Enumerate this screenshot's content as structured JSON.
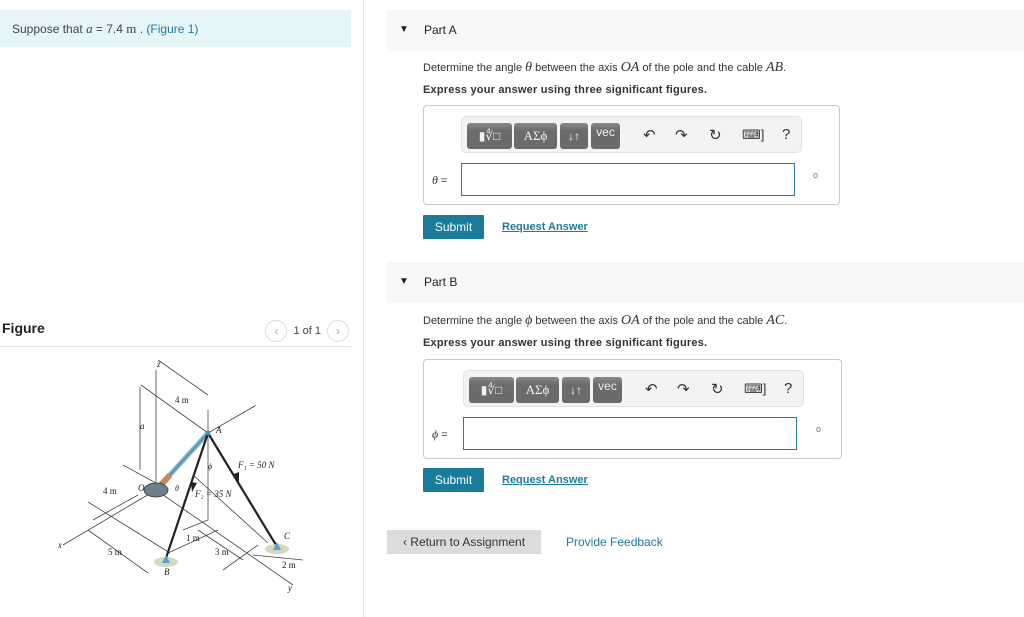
{
  "intro": {
    "prefix": "Suppose that ",
    "variable": "a",
    "equals": " = 7.4 ",
    "unit": "m",
    "suffix": " . ",
    "figure_link": "(Figure 1)"
  },
  "figure_panel": {
    "title": "Figure",
    "pager_text": "1 of 1",
    "prev_icon": "‹",
    "next_icon": "›",
    "labels": {
      "z": "z",
      "x": "x",
      "y": "y",
      "a": "a",
      "O": "O",
      "A": "A",
      "B": "B",
      "C": "C",
      "dim_4m_top": "4 m",
      "dim_4m_left": "4 m",
      "dim_5m": "5 m",
      "dim_1m": "1 m",
      "dim_3m": "3 m",
      "dim_2m": "2 m",
      "theta": "θ",
      "phi": "ϕ",
      "F1": "F₁ = 50 N",
      "F2": "F₂ = 35 N"
    }
  },
  "parts": [
    {
      "title": "Part A",
      "question_pre": "Determine the angle ",
      "symbol": "θ",
      "question_mid": " between the axis ",
      "axis": "OA",
      "question_mid2": " of the pole and the cable ",
      "cable": "AB",
      "question_end": ".",
      "instruction": "Express your answer using three significant figures.",
      "var_label": "θ",
      "input_value": "",
      "unit_symbol": "o",
      "submit_label": "Submit",
      "request_label": "Request Answer"
    },
    {
      "title": "Part B",
      "question_pre": "Determine the angle ",
      "symbol": "ϕ",
      "question_mid": " between the axis ",
      "axis": "OA",
      "question_mid2": " of the pole and the cable ",
      "cable": "AC",
      "question_end": ".",
      "instruction": "Express your answer using three significant figures.",
      "var_label": "ϕ",
      "input_value": "",
      "unit_symbol": "o",
      "submit_label": "Submit",
      "request_label": "Request Answer"
    }
  ],
  "toolbar": {
    "templates": "▮∜□",
    "greek": "ΑΣϕ",
    "arrows": "↓↑",
    "vec": "vec",
    "undo": "↶",
    "redo": "↷",
    "reset": "↻",
    "keyboard": "⌨]",
    "help": "?"
  },
  "footer": {
    "return_label": "‹ Return to Assignment",
    "feedback_label": "Provide Feedback"
  }
}
